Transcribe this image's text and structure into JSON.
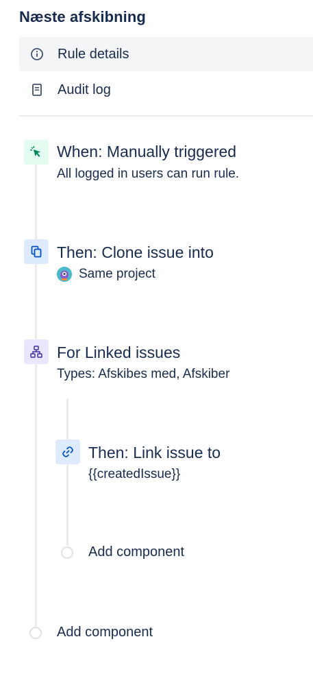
{
  "rule": {
    "title": "Næste afskibning"
  },
  "nav": {
    "items": [
      {
        "label": "Rule details",
        "icon": "info-icon",
        "active": true
      },
      {
        "label": "Audit log",
        "icon": "document-icon",
        "active": false
      }
    ]
  },
  "steps": {
    "trigger": {
      "title": "When: Manually triggered",
      "subtitle": "All logged in users can run rule.",
      "icon": "cursor-icon",
      "color": "#00875a",
      "bg": "#e3fcef"
    },
    "clone": {
      "title": "Then: Clone issue into",
      "subtitle": "Same project",
      "icon": "clone-icon",
      "color": "#0052cc",
      "bg": "#deebff"
    },
    "branch": {
      "title": "For Linked issues",
      "subtitle": "Types: Afskibes med, Afskiber",
      "icon": "hierarchy-icon",
      "color": "#5243aa",
      "bg": "#eae6ff"
    },
    "link": {
      "title": "Then: Link issue to",
      "subtitle": "{{createdIssue}}",
      "icon": "link-icon",
      "color": "#0052cc",
      "bg": "#deebff"
    }
  },
  "actions": {
    "add_component_inner": "Add component",
    "add_component_outer": "Add component"
  }
}
